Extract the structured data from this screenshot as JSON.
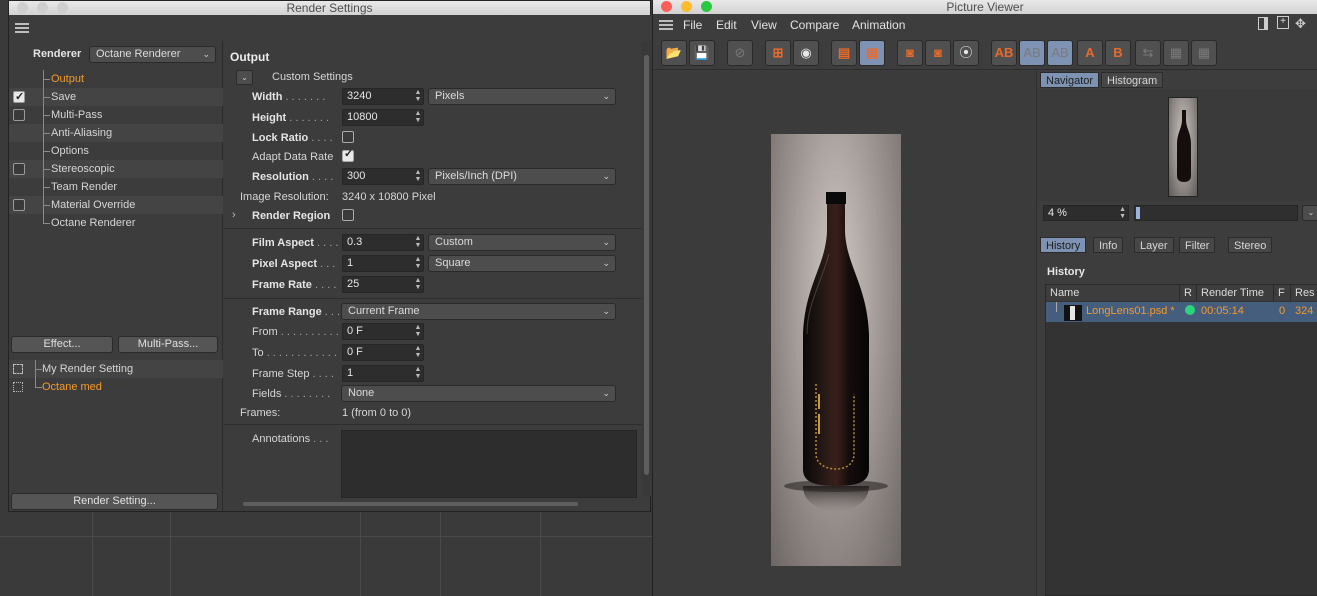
{
  "render_settings": {
    "window_title": "Render Settings",
    "renderer_label": "Renderer",
    "renderer_value": "Octane Renderer",
    "tree": [
      {
        "label": "Output",
        "active": true,
        "checkbox": "none"
      },
      {
        "label": "Save",
        "checkbox": "checked"
      },
      {
        "label": "Multi-Pass",
        "checkbox": "unchecked"
      },
      {
        "label": "Anti-Aliasing",
        "checkbox": "none"
      },
      {
        "label": "Options",
        "checkbox": "none"
      },
      {
        "label": "Stereoscopic",
        "checkbox": "unchecked"
      },
      {
        "label": "Team Render",
        "checkbox": "none"
      },
      {
        "label": "Material Override",
        "checkbox": "unchecked"
      },
      {
        "label": "Octane Renderer",
        "checkbox": "none"
      }
    ],
    "effect_button": "Effect...",
    "multipass_button": "Multi-Pass...",
    "settings_list": [
      {
        "label": "My Render Setting"
      },
      {
        "label": "Octane med",
        "active": true
      }
    ],
    "render_setting_button": "Render Setting...",
    "output": {
      "section_title": "Output",
      "custom_settings": "Custom Settings",
      "width_label": "Width",
      "width_dots": ". . . . . . .",
      "width_value": "3240",
      "width_unit": "Pixels",
      "height_label": "Height",
      "height_dots": ". . . . . . .",
      "height_value": "10800",
      "lock_ratio_label": "Lock Ratio",
      "lock_ratio_dots": ". . . .",
      "adapt_data_rate_label": "Adapt Data Rate",
      "resolution_label": "Resolution",
      "resolution_dots": ". . . .",
      "resolution_value": "300",
      "resolution_unit": "Pixels/Inch (DPI)",
      "image_resolution_label": "Image Resolution:",
      "image_resolution_value": "3240 x 10800 Pixel",
      "render_region_label": "Render Region",
      "film_aspect_label": "Film Aspect",
      "film_aspect_dots": ". . . .",
      "film_aspect_value": "0.3",
      "film_aspect_preset": "Custom",
      "pixel_aspect_label": "Pixel Aspect",
      "pixel_aspect_dots": ". . .",
      "pixel_aspect_value": "1",
      "pixel_aspect_preset": "Square",
      "frame_rate_label": "Frame Rate",
      "frame_rate_dots": ". . . .",
      "frame_rate_value": "25",
      "frame_range_label": "Frame Range",
      "frame_range_dots": ". . .",
      "frame_range_value": "Current Frame",
      "from_label": "From",
      "from_dots": ". . . . . . . . . .",
      "from_value": "0 F",
      "to_label": "To",
      "to_dots": ". . . . . . . . . . . .",
      "to_value": "0 F",
      "frame_step_label": "Frame Step",
      "frame_step_dots": ". . . .",
      "frame_step_value": "1",
      "fields_label": "Fields",
      "fields_dots": ". . . . . . . .",
      "fields_value": "None",
      "frames_label": "Frames:",
      "frames_value": "1 (from 0 to 0)",
      "annotations_label": "Annotations",
      "annotations_dots": ". . ."
    }
  },
  "picture_viewer": {
    "window_title": "Picture Viewer",
    "menu": [
      "File",
      "Edit",
      "View",
      "Compare",
      "Animation"
    ],
    "nav_tabs": [
      "Navigator",
      "Histogram"
    ],
    "zoom_value": "4 %",
    "bottom_tabs": [
      "History",
      "Info",
      "Layer",
      "Filter",
      "Stereo"
    ],
    "history_title": "History",
    "columns": [
      "Name",
      "R",
      "Render Time",
      "F",
      "Res"
    ],
    "rows": [
      {
        "name": "LongLens01.psd *",
        "time": "00:05:14",
        "frame": "0",
        "res": "324"
      }
    ]
  },
  "colors": {
    "accent": "#f39a2d",
    "selection": "#7e93b4",
    "status_ok": "#2bd37a"
  }
}
